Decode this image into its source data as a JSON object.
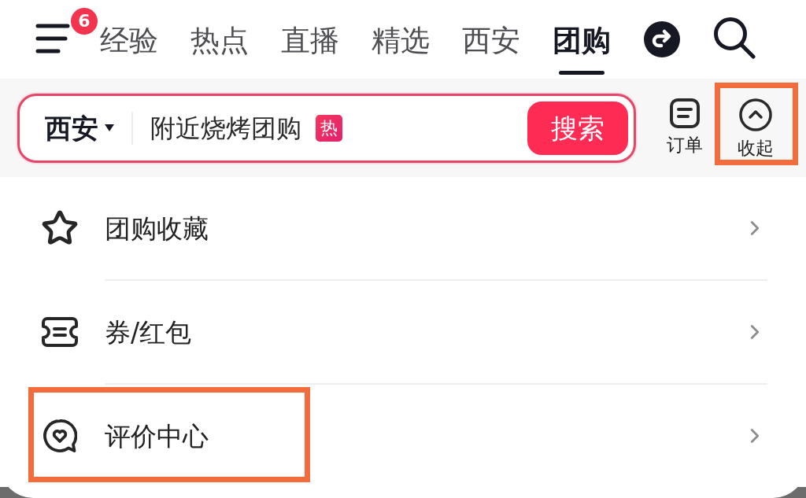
{
  "top_bar": {
    "menu_badge": "6",
    "tabs": [
      {
        "label": "经验",
        "selected": false
      },
      {
        "label": "热点",
        "selected": false
      },
      {
        "label": "直播",
        "selected": false
      },
      {
        "label": "精选",
        "selected": false
      },
      {
        "label": "西安",
        "selected": false
      },
      {
        "label": "团购",
        "selected": true
      }
    ]
  },
  "search_bar": {
    "city": "西安",
    "placeholder": "附近烧烤团购",
    "tag": "热",
    "button": "搜索"
  },
  "quick_actions": [
    {
      "kind": "order",
      "label": "订单",
      "highlighted": false
    },
    {
      "kind": "collapse",
      "label": "收起",
      "highlighted": true
    }
  ],
  "menu": {
    "items": [
      {
        "kind": "favorites",
        "label": "团购收藏",
        "highlighted": false
      },
      {
        "kind": "coupons",
        "label": "券/红包",
        "highlighted": false
      },
      {
        "kind": "reviews",
        "label": "评价中心",
        "highlighted": true
      }
    ]
  }
}
